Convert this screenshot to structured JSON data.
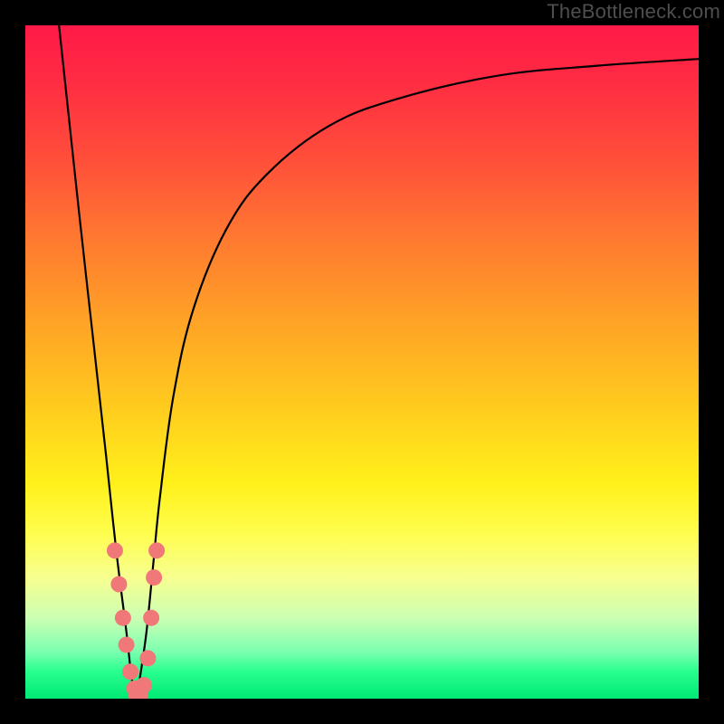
{
  "watermark": "TheBottleneck.com",
  "colors": {
    "frame": "#000000",
    "curve": "#000000",
    "dot": "#f07878",
    "bg_stops": [
      "#ff1a47",
      "#ff7a30",
      "#fff01a",
      "#00e874"
    ]
  },
  "chart_data": {
    "type": "line",
    "title": "",
    "xlabel": "",
    "ylabel": "",
    "xlim": [
      0,
      100
    ],
    "ylim": [
      0,
      100
    ],
    "series": [
      {
        "name": "bottleneck-curve",
        "x": [
          5,
          8,
          10,
          12,
          13.5,
          15,
          15.8,
          16.5,
          17,
          18,
          19,
          20,
          22,
          25,
          30,
          36,
          45,
          55,
          70,
          85,
          100
        ],
        "y": [
          100,
          72,
          54,
          36,
          22,
          10,
          3,
          0,
          3,
          10,
          20,
          30,
          45,
          58,
          70,
          78,
          85,
          89,
          92.5,
          94,
          95
        ]
      }
    ],
    "points": [
      {
        "x": 13.3,
        "y": 22
      },
      {
        "x": 13.9,
        "y": 17
      },
      {
        "x": 14.5,
        "y": 12
      },
      {
        "x": 15.0,
        "y": 8
      },
      {
        "x": 15.6,
        "y": 4
      },
      {
        "x": 16.2,
        "y": 1.5
      },
      {
        "x": 16.5,
        "y": 0.5
      },
      {
        "x": 17.0,
        "y": 0.5
      },
      {
        "x": 17.6,
        "y": 2
      },
      {
        "x": 18.2,
        "y": 6
      },
      {
        "x": 18.7,
        "y": 12
      },
      {
        "x": 19.1,
        "y": 18
      },
      {
        "x": 19.5,
        "y": 22
      }
    ],
    "notch_x": 16.5
  }
}
